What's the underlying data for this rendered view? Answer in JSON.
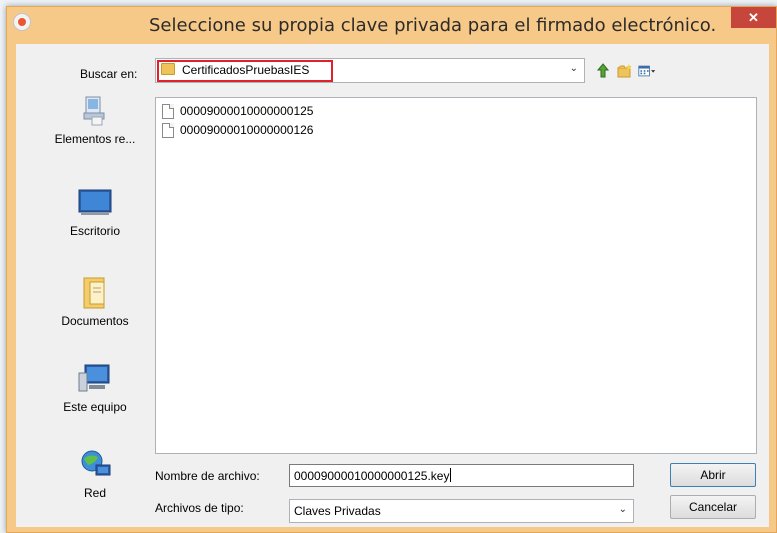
{
  "window": {
    "title": "Seleccione su propia clave privada para el firmado electrónico.",
    "close_symbol": "✕"
  },
  "lookin": {
    "label": "Buscar en:",
    "value": "CertificadosPruebasIES"
  },
  "toolbar": {
    "icons": [
      "up-folder-icon",
      "new-folder-icon",
      "view-menu-icon"
    ]
  },
  "places": [
    {
      "label": "Elementos re...",
      "icon": "recent-items-icon"
    },
    {
      "label": "Escritorio",
      "icon": "desktop-icon"
    },
    {
      "label": "Documentos",
      "icon": "documents-icon"
    },
    {
      "label": "Este equipo",
      "icon": "computer-icon"
    },
    {
      "label": "Red",
      "icon": "network-icon"
    }
  ],
  "files": [
    "00009000010000000125",
    "00009000010000000126"
  ],
  "filename": {
    "label": "Nombre de archivo:",
    "value": "00009000010000000125.key"
  },
  "filetype": {
    "label": "Archivos de tipo:",
    "value": "Claves Privadas"
  },
  "buttons": {
    "open": "Abrir",
    "cancel": "Cancelar"
  },
  "colors": {
    "frame": "#f7c988",
    "close": "#c7463c",
    "highlight": "#e0202a"
  }
}
